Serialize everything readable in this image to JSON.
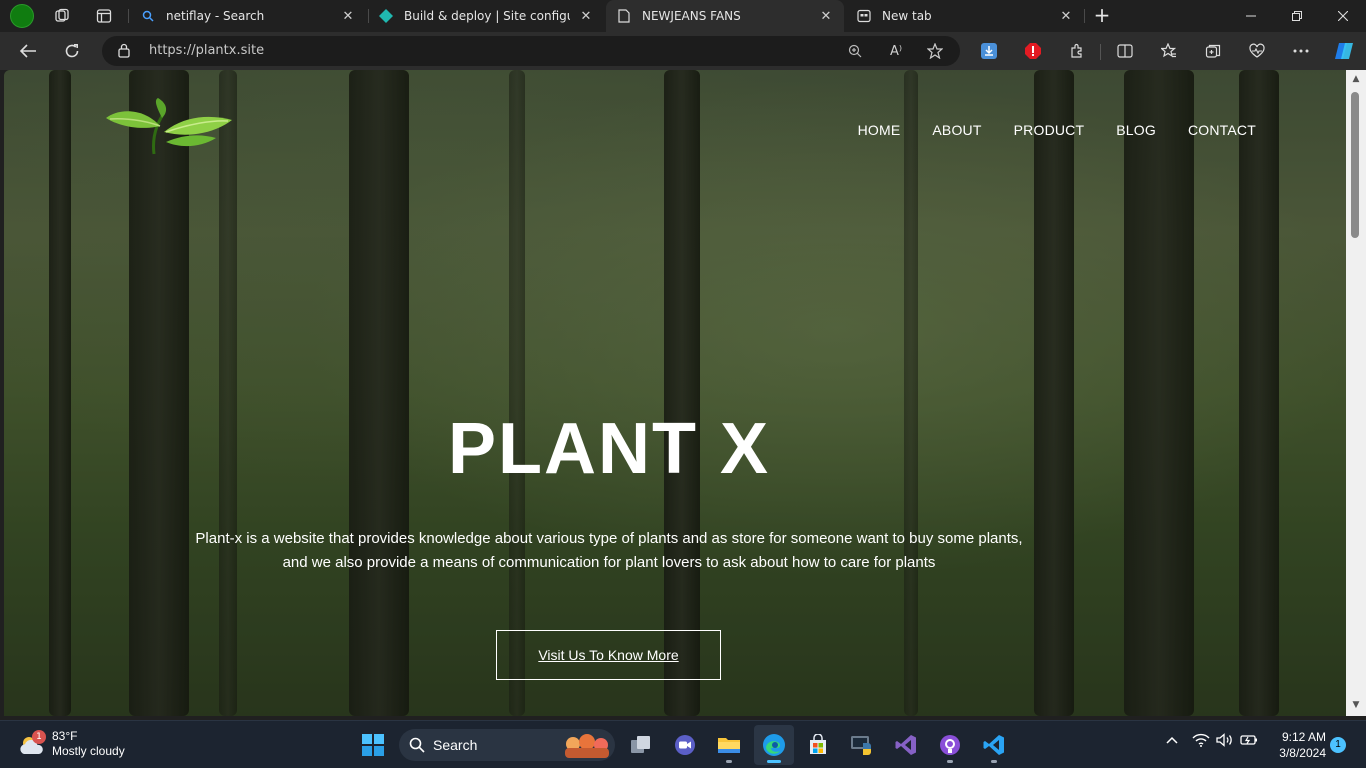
{
  "browser": {
    "tabs": [
      {
        "title": "netiflay - Search",
        "icon": "search-icon"
      },
      {
        "title": "Build & deploy | Site configuratio",
        "icon": "netlify-icon"
      },
      {
        "title": "NEWJEANS FANS",
        "icon": "page-icon"
      },
      {
        "title": "New tab",
        "icon": "newtab-icon"
      }
    ],
    "url": "https://plantx.site"
  },
  "site": {
    "nav": [
      "HOME",
      "ABOUT",
      "PRODUCT",
      "BLOG",
      "CONTACT"
    ],
    "title": "PLANT X",
    "description_line1": "Plant-x is a website that provides knowledge about various type of plants and as store for someone want to buy some plants,",
    "description_line2": "and we also provide a means of communication for plant lovers to ask about how to care for plants",
    "cta": "Visit Us To Know More"
  },
  "taskbar": {
    "weather_temp": "83°F",
    "weather_desc": "Mostly cloudy",
    "weather_badge": "1",
    "search_label": "Search",
    "time": "9:12 AM",
    "date": "3/8/2024",
    "notifications": "1"
  },
  "colors": {
    "accent_green": "#107c10",
    "taskbar_bg": "#1c2430",
    "browser_bg": "#202020"
  }
}
